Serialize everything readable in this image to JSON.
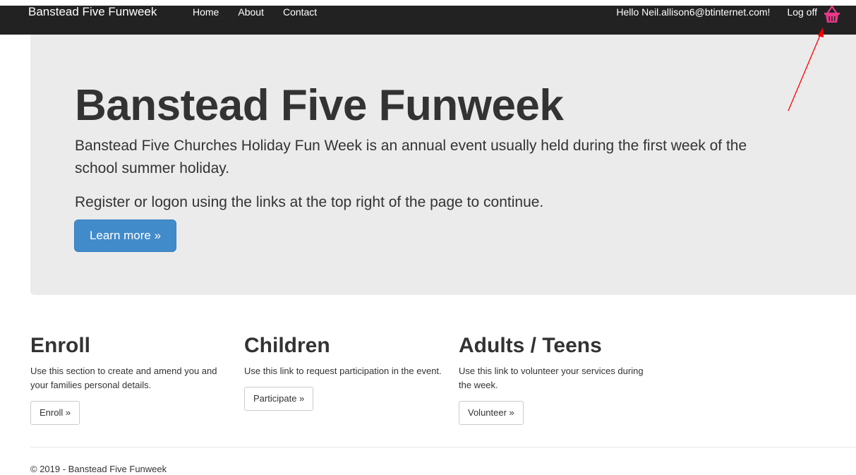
{
  "navbar": {
    "brand": "Banstead Five Funweek",
    "links": [
      {
        "label": "Home"
      },
      {
        "label": "About"
      },
      {
        "label": "Contact"
      }
    ],
    "greeting": "Hello Neil.allison6@btinternet.com!",
    "logoff": "Log off",
    "basket_icon": "shopping-basket-icon"
  },
  "jumbotron": {
    "title": "Banstead Five Funweek",
    "paragraph1": "Banstead Five Churches Holiday Fun Week is an annual event usually held during the first week of the school summer holiday.",
    "paragraph2": "Register or logon using the links at the top right of the page to continue.",
    "button": "Learn more »"
  },
  "sections": [
    {
      "heading": "Enroll",
      "text": "Use this section to create and amend you and your families personal details.",
      "button": "Enroll »"
    },
    {
      "heading": "Children",
      "text": "Use this link to request participation in the event.",
      "button": "Participate »"
    },
    {
      "heading": "Adults / Teens",
      "text": "Use this link to volunteer your services during the week.",
      "button": "Volunteer »"
    }
  ],
  "footer": {
    "text": "© 2019 - Banstead Five Funweek"
  },
  "colors": {
    "navbar": "#222222",
    "jumbotron": "#ebebeb",
    "primary": "#428bca",
    "basket": "#e8388a",
    "annotation_arrow": "#ff0000"
  }
}
